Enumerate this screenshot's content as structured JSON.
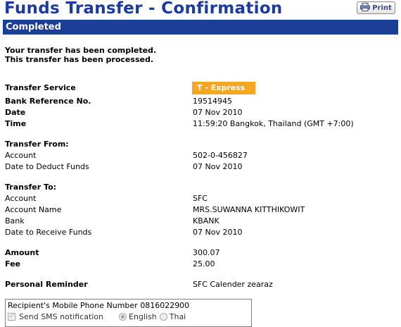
{
  "header": {
    "title": "Funds Transfer - Confirmation",
    "print_label": "Print",
    "print_icon": "printer-icon"
  },
  "banner": {
    "label": "Completed"
  },
  "messages": {
    "line1": "Your transfer has been completed.",
    "line2": "This transfer has been processed."
  },
  "service": {
    "label": "Transfer Service",
    "badge": "T - Express",
    "badge_color": "#f5a623"
  },
  "details": {
    "bank_ref_label": "Bank Reference No.",
    "bank_ref_value": "19514945",
    "date_label": "Date",
    "date_value": "07 Nov 2010",
    "time_label": "Time",
    "time_value": "11:59:20 Bangkok, Thailand (GMT +7:00)"
  },
  "transfer_from": {
    "heading": "Transfer From:",
    "account_label": "Account",
    "account_value": "502-0-456827",
    "deduct_label": "Date to Deduct Funds",
    "deduct_value": "07 Nov 2010"
  },
  "transfer_to": {
    "heading": "Transfer To:",
    "account_label": "Account",
    "account_value": "SFC",
    "name_label": "Account Name",
    "name_value": "MRS.SUWANNA KITTHIKOWIT",
    "bank_label": "Bank",
    "bank_value": "KBANK",
    "receive_label": "Date to Receive Funds",
    "receive_value": "07 Nov 2010"
  },
  "amounts": {
    "amount_label": "Amount",
    "amount_value": "300.07",
    "fee_label": "Fee",
    "fee_value": "25.00"
  },
  "reminder": {
    "label": "Personal Reminder",
    "value": "SFC Calender zearaz"
  },
  "sms": {
    "phone_text": "Recipient's Mobile Phone Number 0816022900",
    "send_label": "Send SMS notification",
    "send_checked": true,
    "lang_english": "English",
    "lang_thai": "Thai",
    "selected_lang": "English"
  },
  "colors": {
    "title": "#1c3aa0",
    "banner_bg": "#1b3f97"
  }
}
